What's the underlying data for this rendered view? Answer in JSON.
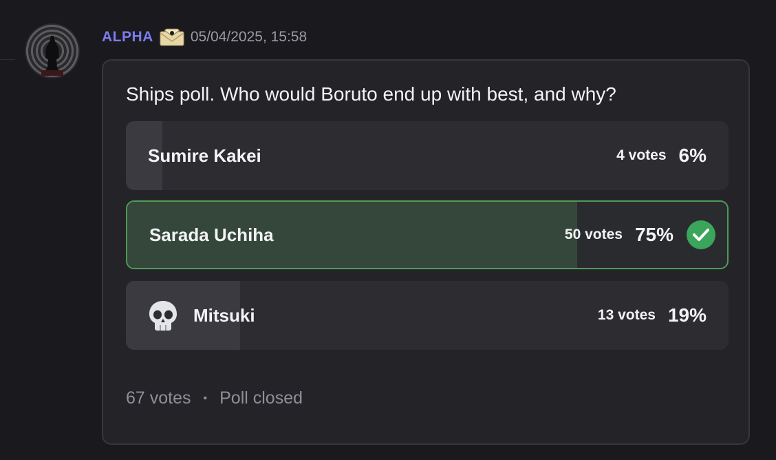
{
  "message": {
    "author": "ALPHA",
    "timestamp": "05/04/2025, 15:58",
    "author_color": "#7c7cf0",
    "badge_icon": "envelope-badge-icon",
    "avatar_icon": "avatar-silhouette"
  },
  "poll": {
    "question": "Ships poll. Who would Boruto end up with best, and why?",
    "answers": [
      {
        "label": "Sumire Kakei",
        "votes_text": "4 votes",
        "percent_text": "6%",
        "fraction": 0.06,
        "winner": false,
        "emoji": ""
      },
      {
        "label": "Sarada Uchiha",
        "votes_text": "50 votes",
        "percent_text": "75%",
        "fraction": 0.75,
        "winner": true,
        "emoji": ""
      },
      {
        "label": "Mitsuki",
        "votes_text": "13 votes",
        "percent_text": "19%",
        "fraction": 0.19,
        "winner": false,
        "emoji": "skull-icon"
      }
    ],
    "total_votes_text": "67 votes",
    "separator": "•",
    "status_text": "Poll closed",
    "colors": {
      "winner_border": "#4f9a57",
      "winner_fill": "#35473a",
      "check": "#3ba55c"
    }
  }
}
